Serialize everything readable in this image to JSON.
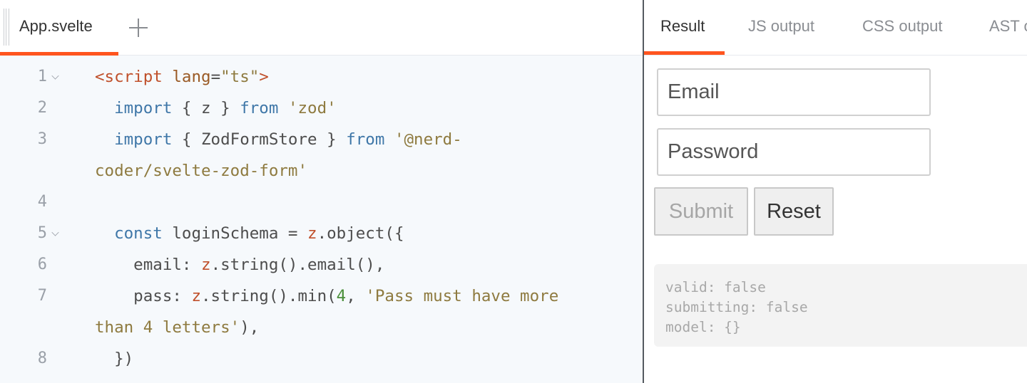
{
  "editor": {
    "file_tab_label": "App.svelte",
    "add_file_icon": "plus-icon",
    "lines": [
      {
        "no": "1",
        "fold": true,
        "segments": [
          [
            "t-tag",
            "<script"
          ],
          [
            "t-plain",
            " "
          ],
          [
            "t-attr",
            "lang"
          ],
          [
            "t-plain",
            "="
          ],
          [
            "t-str",
            "\"ts\""
          ],
          [
            "t-tag",
            ">"
          ]
        ]
      },
      {
        "no": "2",
        "fold": false,
        "segments": [
          [
            "t-plain",
            "  "
          ],
          [
            "t-kw",
            "import"
          ],
          [
            "t-plain",
            " { z } "
          ],
          [
            "t-kw",
            "from"
          ],
          [
            "t-plain",
            " "
          ],
          [
            "t-str",
            "'zod'"
          ]
        ]
      },
      {
        "no": "3",
        "fold": false,
        "segments": [
          [
            "t-plain",
            "  "
          ],
          [
            "t-kw",
            "import"
          ],
          [
            "t-plain",
            " { ZodFormStore } "
          ],
          [
            "t-kw",
            "from"
          ],
          [
            "t-plain",
            " "
          ],
          [
            "t-str",
            "'@nerd-"
          ]
        ]
      },
      {
        "no": "",
        "fold": false,
        "segments": [
          [
            "t-str",
            "coder/svelte-zod-form'"
          ]
        ]
      },
      {
        "no": "4",
        "fold": false,
        "segments": []
      },
      {
        "no": "5",
        "fold": true,
        "segments": [
          [
            "t-plain",
            "  "
          ],
          [
            "t-kw",
            "const"
          ],
          [
            "t-plain",
            " loginSchema = "
          ],
          [
            "t-var",
            "z"
          ],
          [
            "t-plain",
            ".object({"
          ]
        ]
      },
      {
        "no": "6",
        "fold": false,
        "segments": [
          [
            "t-plain",
            "    email: "
          ],
          [
            "t-var",
            "z"
          ],
          [
            "t-plain",
            ".string().email(),"
          ]
        ]
      },
      {
        "no": "7",
        "fold": false,
        "segments": [
          [
            "t-plain",
            "    pass: "
          ],
          [
            "t-var",
            "z"
          ],
          [
            "t-plain",
            ".string().min("
          ],
          [
            "t-num",
            "4"
          ],
          [
            "t-plain",
            ", "
          ],
          [
            "t-str",
            "'Pass must have more"
          ]
        ]
      },
      {
        "no": "",
        "fold": false,
        "segments": [
          [
            "t-str",
            "than 4 letters'"
          ],
          [
            "t-plain",
            "),"
          ]
        ]
      },
      {
        "no": "8",
        "fold": false,
        "segments": [
          [
            "t-plain",
            "  })"
          ]
        ]
      }
    ]
  },
  "output": {
    "tabs": [
      "Result",
      "JS output",
      "CSS output",
      "AST output"
    ],
    "active_tab": "Result",
    "email_placeholder": "Email",
    "password_placeholder": "Password",
    "submit_label": "Submit",
    "reset_label": "Reset",
    "debug": [
      "valid: false",
      "submitting: false",
      "model: {}"
    ]
  },
  "colors": {
    "accent": "#ff3e00",
    "editor_bg": "#f6f9fc"
  }
}
